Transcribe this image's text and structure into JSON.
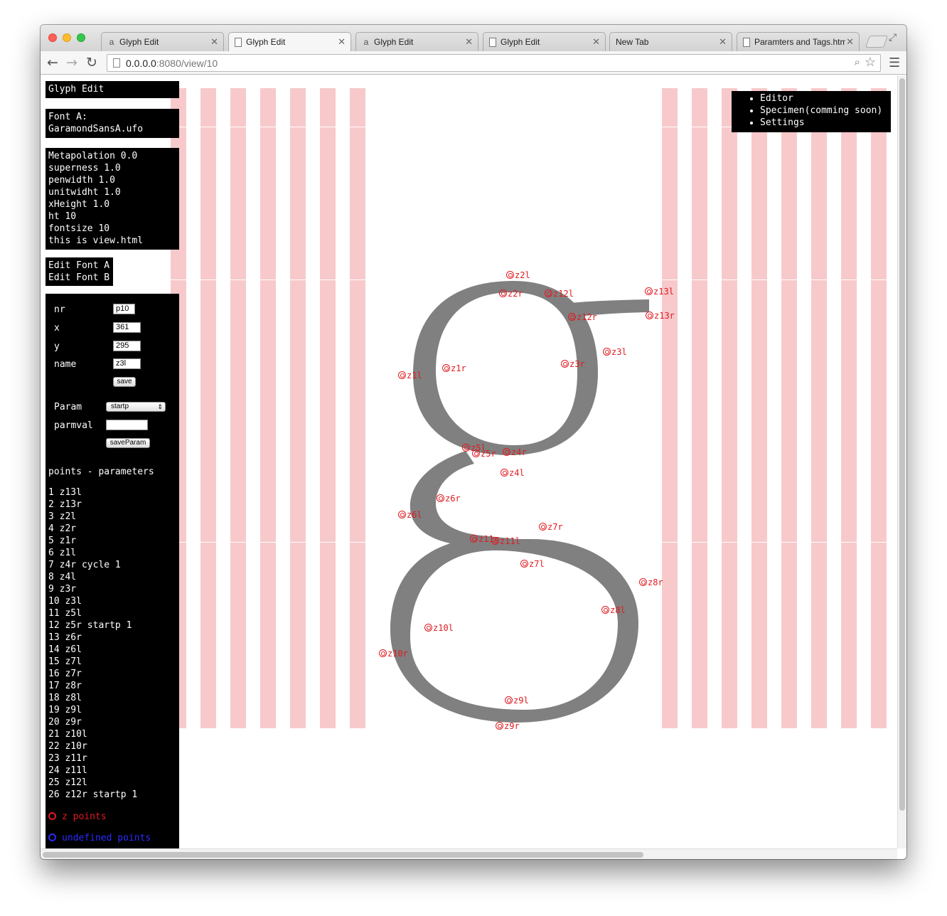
{
  "browser": {
    "tabs": [
      {
        "label": "Glyph Edit",
        "icon": "a-favicon-icon",
        "active": false
      },
      {
        "label": "Glyph Edit",
        "icon": "document-icon",
        "active": true
      },
      {
        "label": "Glyph Edit",
        "icon": "a-favicon-icon",
        "active": false
      },
      {
        "label": "Glyph Edit",
        "icon": "document-icon",
        "active": false
      },
      {
        "label": "New Tab",
        "icon": "",
        "active": false
      },
      {
        "label": "Paramters and Tags.htm",
        "icon": "document-icon",
        "active": false
      }
    ],
    "url_host": "0.0.0.0",
    "url_path": ":8080/view/10"
  },
  "sidebar": {
    "title": "Glyph Edit",
    "font_label": "Font A:",
    "font_file": "GaramondSansA.ufo",
    "params": [
      "Metapolation 0.0",
      "superness 1.0",
      "penwidth 1.0",
      "unitwidht 1.0",
      "xHeight 1.0",
      "ht 10",
      "fontsize 10",
      "this is view.html"
    ],
    "edit_links": [
      "Edit Font A",
      "Edit Font B"
    ],
    "form": {
      "nr_label": "nr",
      "nr_value": "p10",
      "x_label": "x",
      "x_value": "361",
      "y_label": "y",
      "y_value": "295",
      "name_label": "name",
      "name_value": "z3l",
      "save_label": "save",
      "param_label": "Param",
      "param_selected": "startp",
      "parmval_label": "parmval",
      "parmval_value": "",
      "save_param_label": "saveParam"
    },
    "points_heading": "points - parameters",
    "points": [
      "1 z13l",
      "2 z13r",
      "3 z2l",
      "4 z2r",
      "5 z1r",
      "6 z1l",
      "7 z4r cycle 1",
      "8 z4l",
      "9 z3r",
      "10 z3l",
      "11 z5l",
      "12 z5r startp 1",
      "13 z6r",
      "14 z6l",
      "15 z7l",
      "16 z7r",
      "17 z8r",
      "18 z8l",
      "19 z9l",
      "20 z9r",
      "21 z10l",
      "22 z10r",
      "23 z11r",
      "24 z11l",
      "25 z12l",
      "26 z12r startp 1"
    ],
    "legend_z": "z points",
    "legend_undefined": "undefined points",
    "legend_colors": {
      "z": "#e0191f",
      "undefined": "#2a2aff"
    }
  },
  "top_menu": [
    "Editor",
    "Specimen(comming soon)",
    "Settings"
  ],
  "glyph": {
    "character": "g",
    "fill": "#808080",
    "guide_color": "#f7c9cb",
    "point_labels": [
      "z2l",
      "z2r",
      "z12l",
      "z13l",
      "z12r",
      "z13r",
      "z3l",
      "z1l",
      "z1r",
      "z3r",
      "z5l",
      "z5r",
      "z4r",
      "z4l",
      "z6r",
      "z6l",
      "z7r",
      "z11r",
      "z11l",
      "z7l",
      "z8r",
      "z8l",
      "z10l",
      "z10r",
      "z9l",
      "z9r"
    ]
  }
}
